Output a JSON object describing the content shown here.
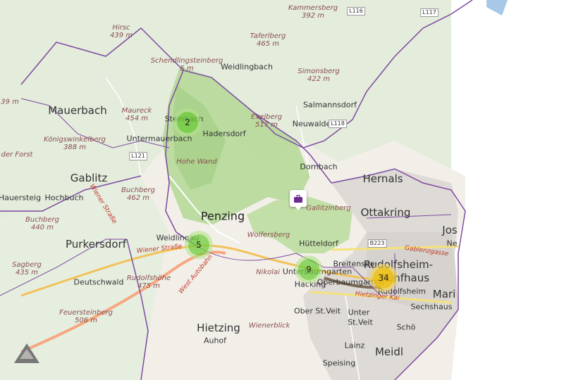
{
  "clusters": [
    {
      "count": "2",
      "color": "green"
    },
    {
      "count": "5",
      "color": "green"
    },
    {
      "count": "9",
      "color": "green"
    },
    {
      "count": "34",
      "color": "yellow"
    }
  ],
  "districts": {
    "mauerbach": "Mauerbach",
    "gablitz": "Gablitz",
    "purkersdorf": "Purkersdorf",
    "penzing": "Penzing",
    "hernals": "Hernals",
    "ottakring": "Ottakring",
    "rudolfsheim": "Rudolfsheim-",
    "fuenfhaus": "Fünfhaus",
    "hietzing": "Hietzing",
    "jos": "Jos",
    "mari": "Mari",
    "meidl": "Meidl"
  },
  "places": {
    "weidlingbach": "Weidlingbach",
    "steinbach": "Steinbach",
    "hadersdorf": "Hadersdorf",
    "untermauerbach": "Untermauerbach",
    "salmannsdorf": "Salmannsdorf",
    "neuwaldegg": "Neuwaldegg",
    "dornbach": "Dornbach",
    "hochbuch": "Hochbuch",
    "hauersteig": "Hauersteig",
    "weidlingau": "Weidlingau",
    "deutschwald": "Deutschwald",
    "huetteldorf": "Hütteldorf",
    "breitensee": "Breitensee",
    "unterbaumgarten": "Unterbaumgarten",
    "oberbaumgarten": "Oberbaumgarten",
    "hacking": "Hacking",
    "rudolfsheim_small": "Rudolfsheim",
    "sechshaus": "Sechshaus",
    "ober_st_veit": "Ober St.Veit",
    "unter": "Unter",
    "st_veit": "St.Veit",
    "lainz": "Lainz",
    "speising": "Speising",
    "auhof": "Auhof",
    "schoe": "Schö",
    "nef": "Ne"
  },
  "peaks": {
    "kammersberg": [
      "Kammersberg",
      "392 m"
    ],
    "hirschberg": [
      "Hirsc",
      "439 m"
    ],
    "taferlberg": [
      "Taferlberg",
      "465 m"
    ],
    "schottenberg": [
      "Schendlingsteinberg",
      "5 m"
    ],
    "simonsberg": [
      "Simonsberg",
      "422 m"
    ],
    "maureck": [
      "Maureck",
      "454 m"
    ],
    "exelberg": [
      "Exelberg",
      "517 m"
    ],
    "koenigswinkel": [
      "Königswinkelberg",
      "388 m"
    ],
    "hoheWand": [
      "Hohe Wand",
      ""
    ],
    "buchberg": [
      "Buchberg",
      "462 m"
    ],
    "buchberg2": [
      "Buchberg",
      "440 m"
    ],
    "sagberg": [
      "Sagberg",
      "435 m"
    ],
    "rudolfshoehe": [
      "Rudolfshöhe",
      "475 m"
    ],
    "feuersteinberg": [
      "Feuersteinberg",
      "506 m"
    ],
    "wolfersberg": [
      "Wolfersberg",
      ""
    ],
    "gallitzinberg": [
      "Gallitzinberg",
      ""
    ],
    "nikolai": [
      "Nikolai",
      ""
    ],
    "wienerblick": [
      "Wienerblick",
      ""
    ],
    "leftedge": [
      "",
      "39 m"
    ],
    "forst": [
      "der Forst",
      ""
    ],
    "berg": [
      "berg",
      ""
    ]
  },
  "roads": {
    "wienerstrasse": "Wiener Straße",
    "westautobahn": "West Autobahn",
    "wienerstr2": "Wiener Straße",
    "hietzinger": "Hietzinger Kai",
    "gablenz": "Gablenzgasse"
  },
  "shields": {
    "l116": "L116",
    "l117": "L117",
    "l118": "L118",
    "l121": "L121",
    "b223": "B223"
  }
}
